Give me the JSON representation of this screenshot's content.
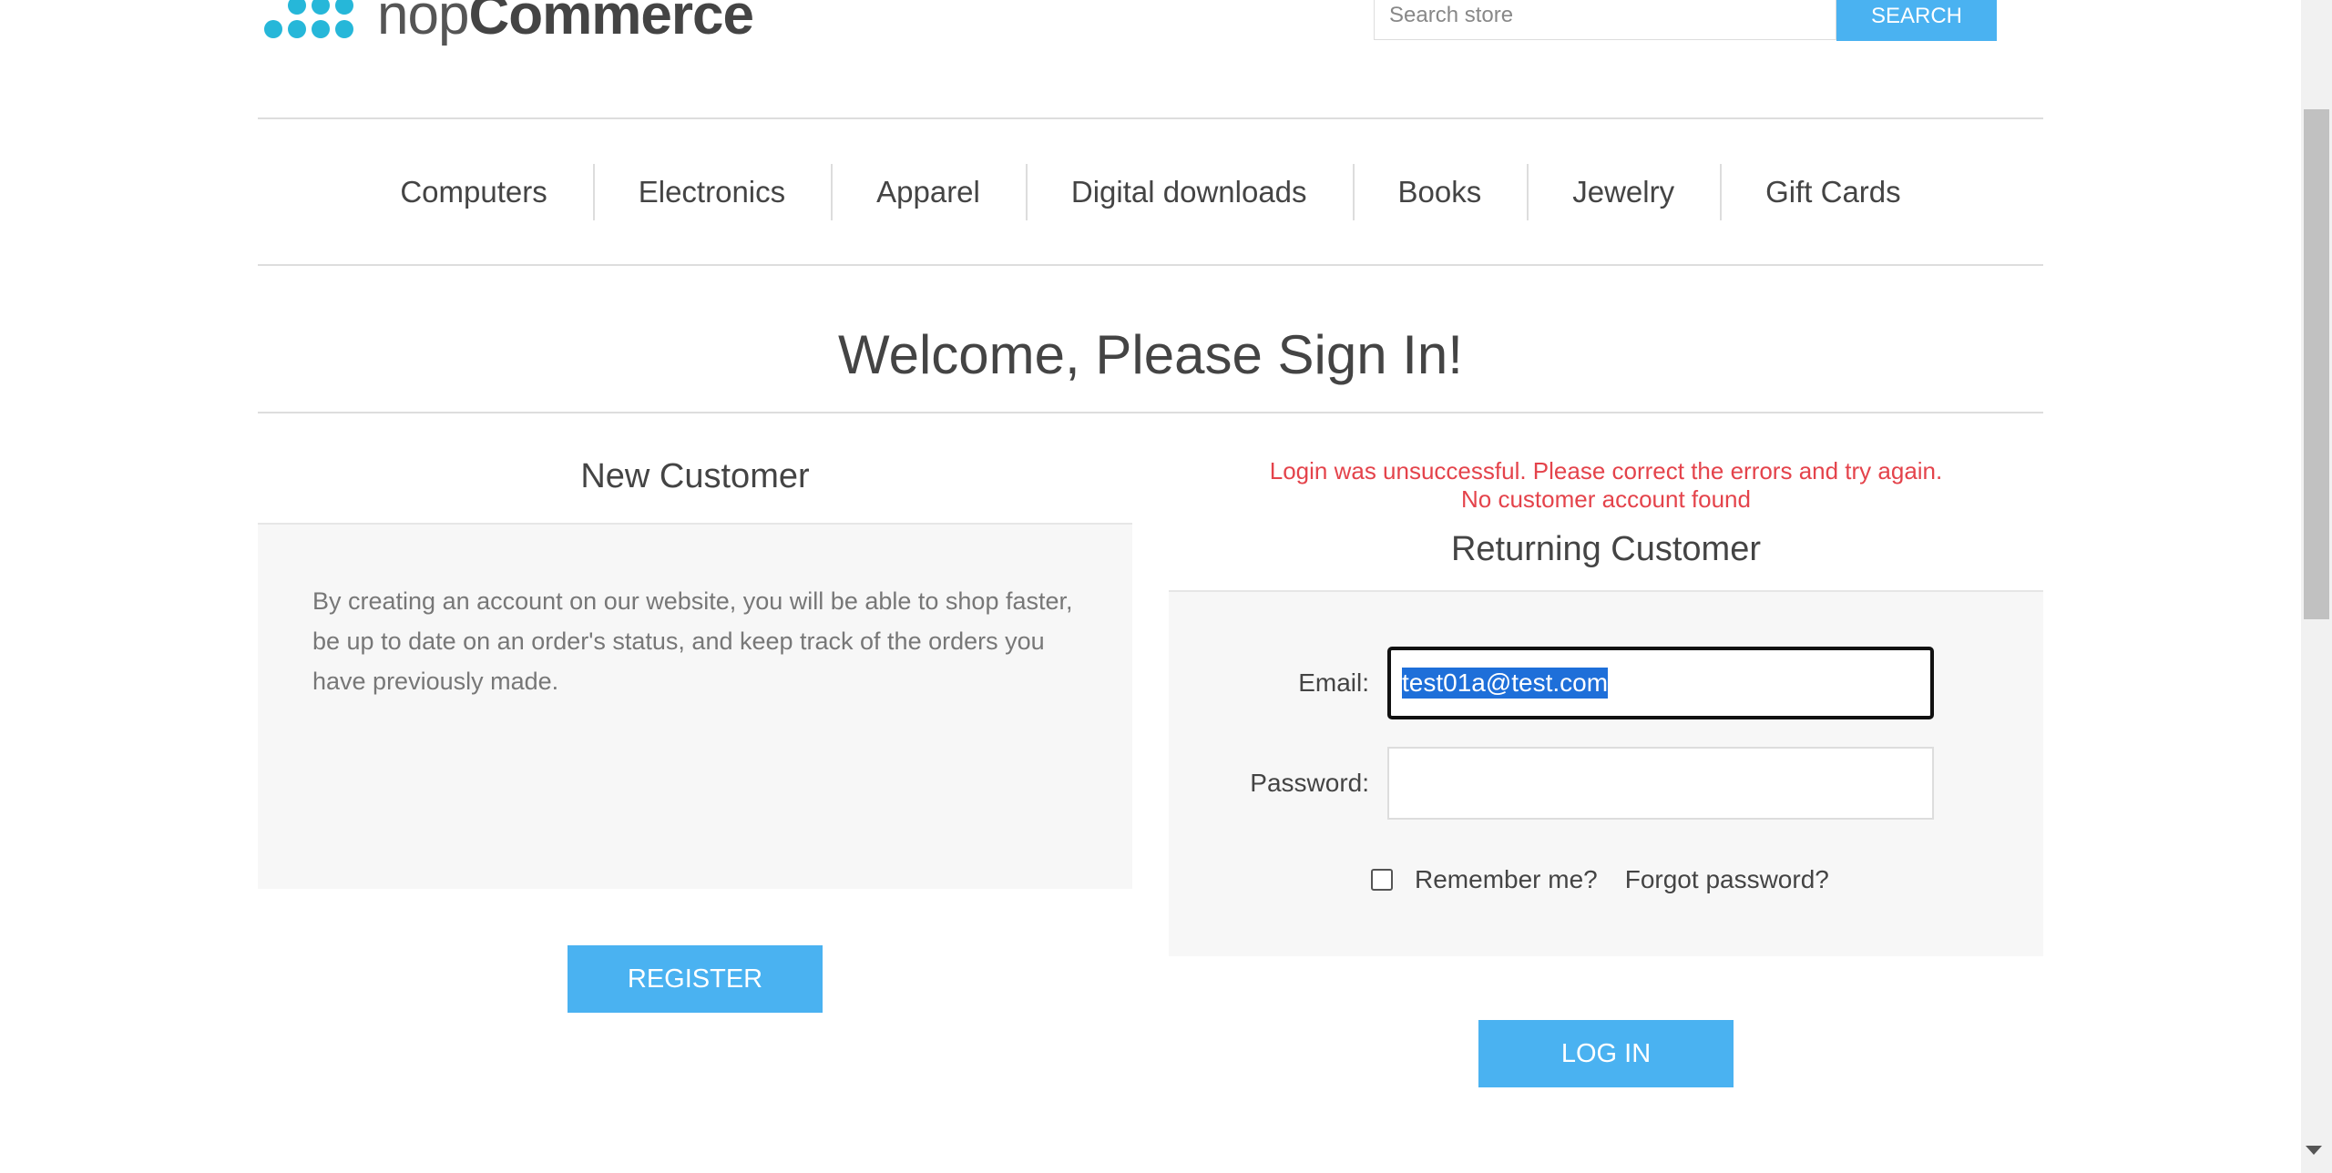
{
  "header": {
    "logo_text_light": "nop",
    "logo_text_bold": "Commerce",
    "search_placeholder": "Search store",
    "search_button": "SEARCH"
  },
  "menu": {
    "items": [
      "Computers",
      "Electronics",
      "Apparel",
      "Digital downloads",
      "Books",
      "Jewelry",
      "Gift Cards"
    ]
  },
  "page": {
    "title": "Welcome, Please Sign In!"
  },
  "new_customer": {
    "title": "New Customer",
    "text": "By creating an account on our website, you will be able to shop faster, be up to date on an order's status, and keep track of the orders you have previously made.",
    "register_button": "REGISTER"
  },
  "returning_customer": {
    "error_line1": "Login was unsuccessful. Please correct the errors and try again.",
    "error_line2": "No customer account found",
    "title": "Returning Customer",
    "email_label": "Email:",
    "email_value": "test01a@test.com",
    "password_label": "Password:",
    "remember_label": "Remember me?",
    "forgot_link": "Forgot password?",
    "login_button": "LOG IN"
  },
  "colors": {
    "accent": "#4ab2f1",
    "error": "#e4434b",
    "logo_blue": "#26b7d9"
  }
}
